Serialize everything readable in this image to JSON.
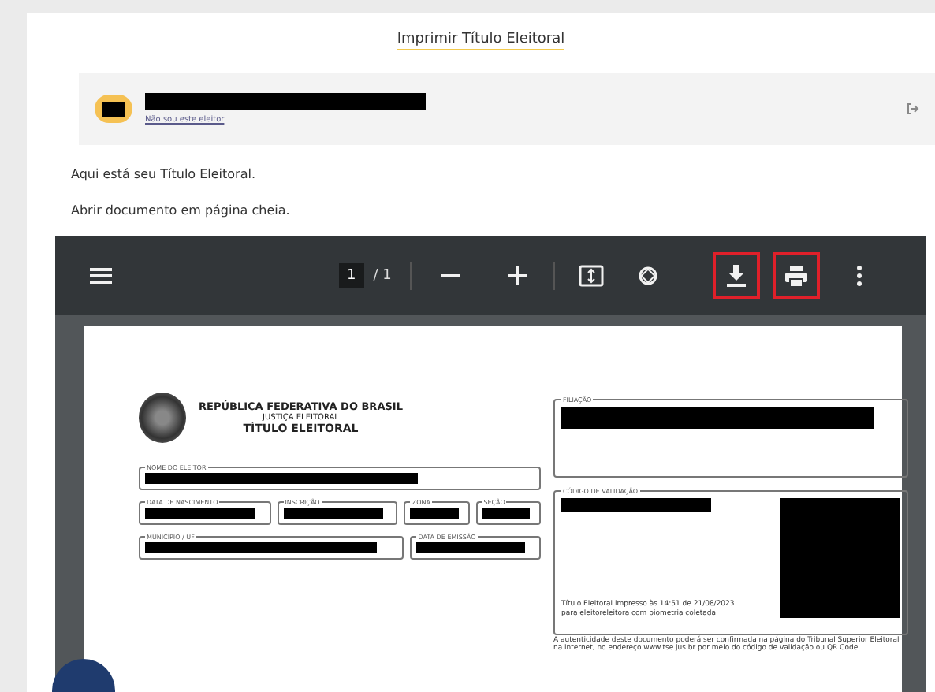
{
  "page_title": "Imprimir Título Eleitoral",
  "user": {
    "link": "Não sou este eleitor"
  },
  "message": "Aqui está seu Título Eleitoral.",
  "open_link": "Abrir documento em página cheia.",
  "viewer": {
    "page_input": "1",
    "page_total": "/ 1",
    "tools": [
      {
        "kind": "menu",
        "highlighted": false
      },
      {
        "kind": "zoom-out",
        "highlighted": false
      },
      {
        "kind": "zoom-in",
        "highlighted": false
      },
      {
        "kind": "fit",
        "highlighted": false
      },
      {
        "kind": "rotate",
        "highlighted": false
      },
      {
        "kind": "download",
        "highlighted": true
      },
      {
        "kind": "print",
        "highlighted": true
      },
      {
        "kind": "more",
        "highlighted": false
      }
    ]
  },
  "document": {
    "header": [
      "REPÚBLICA FEDERATIVA DO BRASIL",
      "JUSTIÇA ELEITORAL",
      "TÍTULO ELEITORAL"
    ],
    "field_rows": [
      [
        {
          "label": "NOME DO ELEITOR"
        }
      ],
      [
        {
          "label": "DATA DE NASCIMENTO"
        },
        {
          "label": "INSCRIÇÃO"
        },
        {
          "label": "ZONA"
        },
        {
          "label": "SEÇÃO"
        }
      ],
      [
        {
          "label": "MUNICÍPIO / UF"
        },
        {
          "label": "DATA DE EMISSÃO"
        }
      ]
    ],
    "filiation_label": "FILIAÇÃO",
    "validation_label": "CÓDIGO DE VALIDAÇÃO",
    "print_note": "Título Eleitoral impresso às 14:51 de 21/08/2023 para eleitoreleitora com biometria coletada",
    "authenticity_note": "A autenticidade deste documento poderá ser confirmada na página do Tribunal Superior Eleitoral na internet, no endereço www.tse.jus.br por meio do código de validação ou QR Code."
  }
}
